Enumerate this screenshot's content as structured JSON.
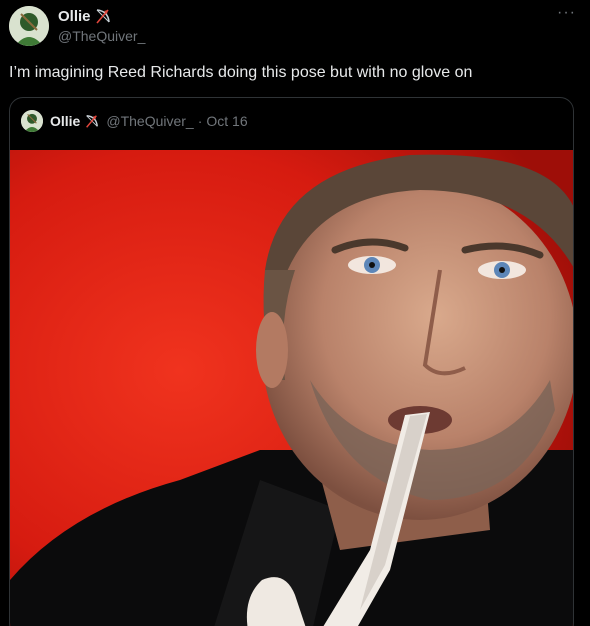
{
  "tweet": {
    "author": {
      "display_name": "Ollie",
      "handle": "@TheQuiver_",
      "avatar_icon": "avatar-image",
      "badge_icon": "bow-and-arrow-emoji"
    },
    "more_label": "···",
    "text": "I’m imagining Reed Richards doing this pose but with no glove on"
  },
  "quote": {
    "author": {
      "display_name": "Ollie",
      "handle": "@TheQuiver_",
      "avatar_icon": "avatar-image",
      "badge_icon": "bow-and-arrow-emoji"
    },
    "separator": "·",
    "date": "Oct 16",
    "media": {
      "description_icon": "photo-man-with-latex-glove",
      "background_color": "#e21d12"
    }
  },
  "colors": {
    "background": "#000000",
    "primary_text": "#e7e9ea",
    "secondary_text": "#71767b",
    "border": "#2f3336"
  }
}
